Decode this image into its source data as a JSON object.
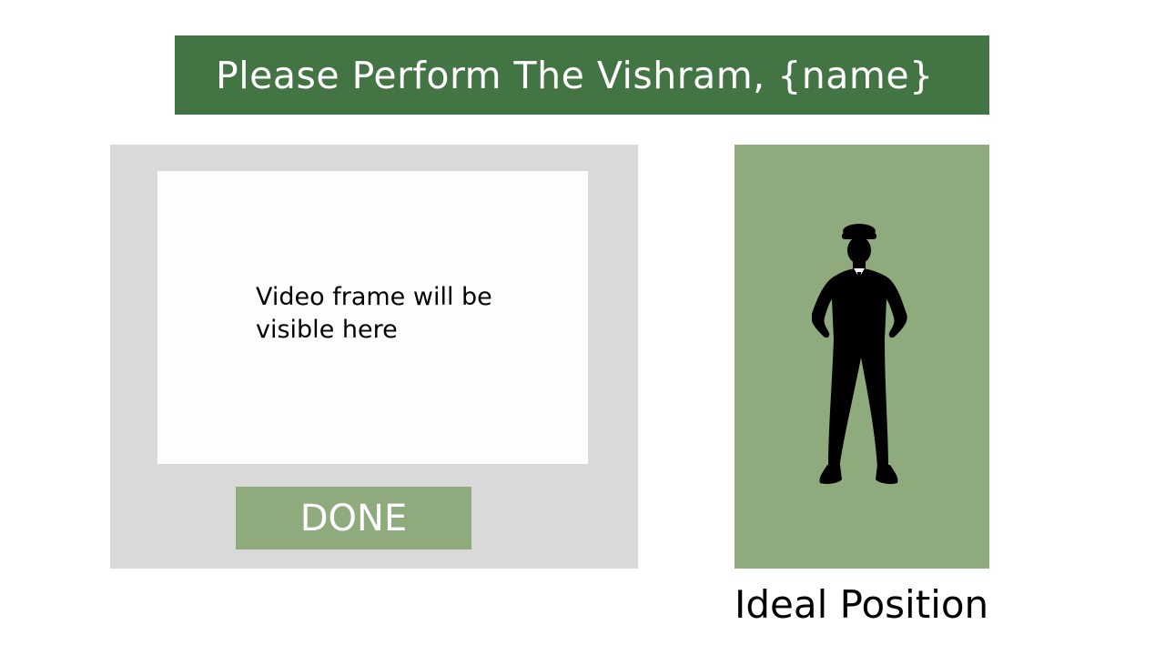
{
  "header": {
    "title": "Please Perform The Vishram, {name}"
  },
  "capture": {
    "placeholder": "Video frame will be visible here",
    "done_label": "DONE"
  },
  "reference": {
    "label": "Ideal Position",
    "figure_icon": "soldier-silhouette-icon"
  },
  "colors": {
    "header_bg": "#437444",
    "accent_green": "#8faa7c",
    "panel_gray": "#d9d9d9",
    "frame_bg": "#fffcfc"
  }
}
